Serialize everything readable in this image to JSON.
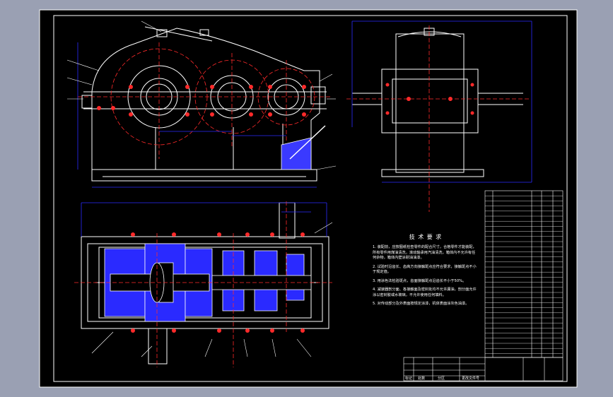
{
  "drawing": {
    "technical_requirements": {
      "title": "技 术 要 求",
      "items": [
        "1. 装配前，应按图纸检查零件的配合尺寸，合格零件才能装配，所有零件用煤油清洗，滚动轴承用汽油清洗，箱体内不允许有任何杂物，箱体内壁涂耐油油漆。",
        "2. 试验时沿齿长、齿高方向接触斑点应符合要求，接触斑点不小于规定值。",
        "3. 用涂色法检验斑点，齿面接触斑点沿齿长不小于50%。",
        "4. 减速器剖分面、各接触面及密封处均不允许漏油，剖分面允许涂以密封胶或水玻璃，不允许使用任何填料。",
        "5. 对传动部分及外表面按规定涂漆，机体表面涂灰色油漆。"
      ]
    },
    "title_block": {
      "labels": [
        "标记",
        "处数",
        "分区",
        "更改文件号",
        "签名",
        "年月日"
      ]
    },
    "colors": {
      "background": "#000000",
      "outline": "#ffffff",
      "centerline": "#ff2a2a",
      "dimension": "#2b2bff",
      "hatch": "#3a3aff",
      "leader": "#00e0ff",
      "table": "#ffffff"
    }
  }
}
